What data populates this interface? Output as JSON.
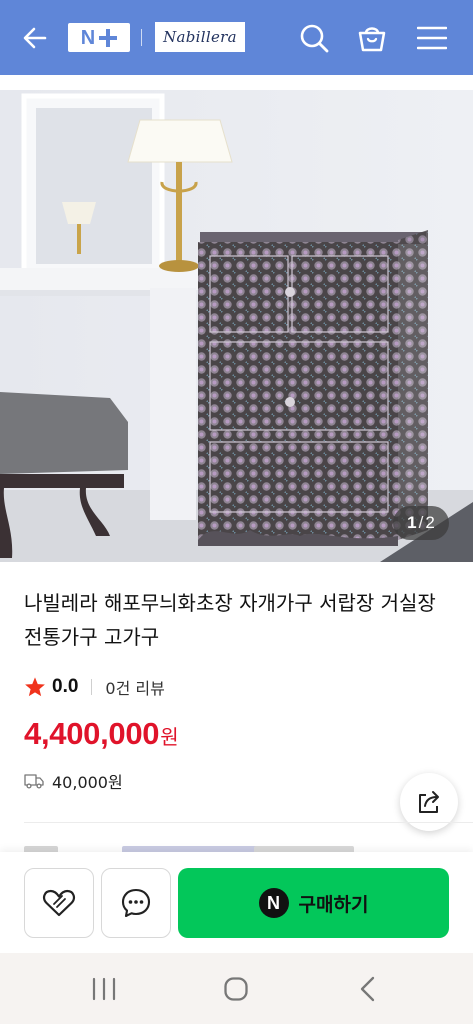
{
  "header": {
    "npay_logo_letter": "N",
    "brand_logo_text": "Nabillera",
    "icons": [
      "back-arrow-icon",
      "search-icon",
      "shopping-bag-icon",
      "hamburger-menu-icon"
    ],
    "background_color": "#5f86d8"
  },
  "product": {
    "image_counter": {
      "current": "1",
      "separator": "/",
      "total": "2"
    },
    "title": "나빌레라 해포무늬화초장 자개가구 서랍장 거실장 전통가구 고가구",
    "rating": "0.0",
    "review_text": "0건 리뷰",
    "price": "4,400,000",
    "price_unit": "원",
    "shipping_fee": "40,000원",
    "accent_color": "#e0132a"
  },
  "actions": {
    "buy_label": "구매하기",
    "npay_badge": "N",
    "buy_color": "#03c75a",
    "icons": [
      "heart-icon",
      "chat-bubble-icon",
      "share-icon"
    ]
  },
  "system_nav": {
    "icons": [
      "recent-apps-icon",
      "home-icon",
      "back-icon"
    ]
  }
}
